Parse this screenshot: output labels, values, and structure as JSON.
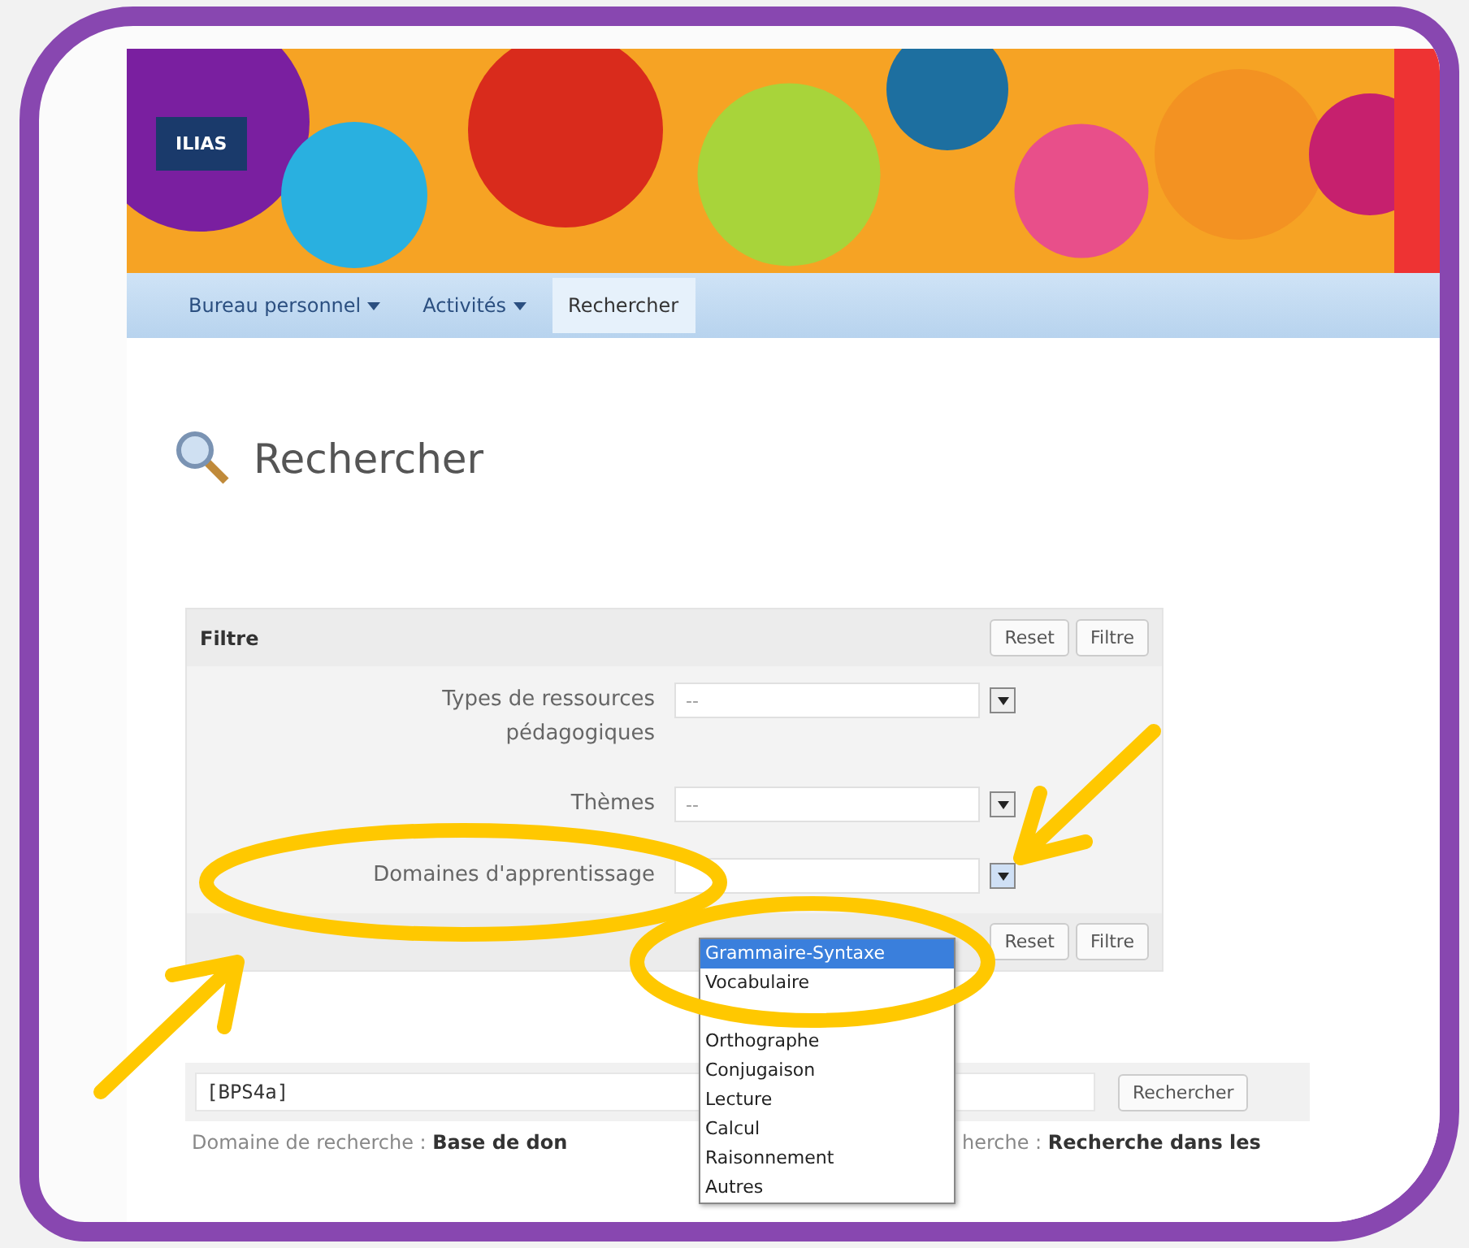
{
  "logo": "ILIAS",
  "nav": [
    {
      "label": "Bureau personnel",
      "dropdown": true,
      "selected": false
    },
    {
      "label": "Activités",
      "dropdown": true,
      "selected": false
    },
    {
      "label": "Rechercher",
      "dropdown": false,
      "selected": true
    }
  ],
  "page_title": "Rechercher",
  "filter": {
    "title": "Filtre",
    "buttons": [
      "Reset",
      "Filtre"
    ],
    "fields": [
      {
        "label": "Types de ressources pédagogiques",
        "placeholder": "--"
      },
      {
        "label": "Thèmes",
        "placeholder": "--"
      },
      {
        "label": "Domaines d'apprentissage",
        "expanded": true
      }
    ],
    "footer_buttons": [
      "Reset",
      "Filtre"
    ]
  },
  "dropdown": [
    {
      "kind": "option",
      "label": "Grammaire-Syntaxe",
      "selected": true
    },
    {
      "kind": "option",
      "label": "Vocabulaire",
      "selected": false
    },
    {
      "kind": "blank",
      "selected": false
    },
    {
      "kind": "option",
      "label": "Orthographe",
      "selected": false
    },
    {
      "kind": "option",
      "label": "Conjugaison",
      "selected": false
    },
    {
      "kind": "option",
      "label": "Lecture",
      "selected": false
    },
    {
      "kind": "option",
      "label": "Calcul",
      "selected": false
    },
    {
      "kind": "option",
      "label": "Raisonnement",
      "selected": false
    },
    {
      "kind": "option",
      "label": "Autres",
      "selected": false
    }
  ],
  "search": {
    "value": "[BPS4a]",
    "button": "Rechercher"
  },
  "search_info": [
    "Domaine de recherche : **Base de don**",
    "herche : **Recherche dans les**"
  ]
}
